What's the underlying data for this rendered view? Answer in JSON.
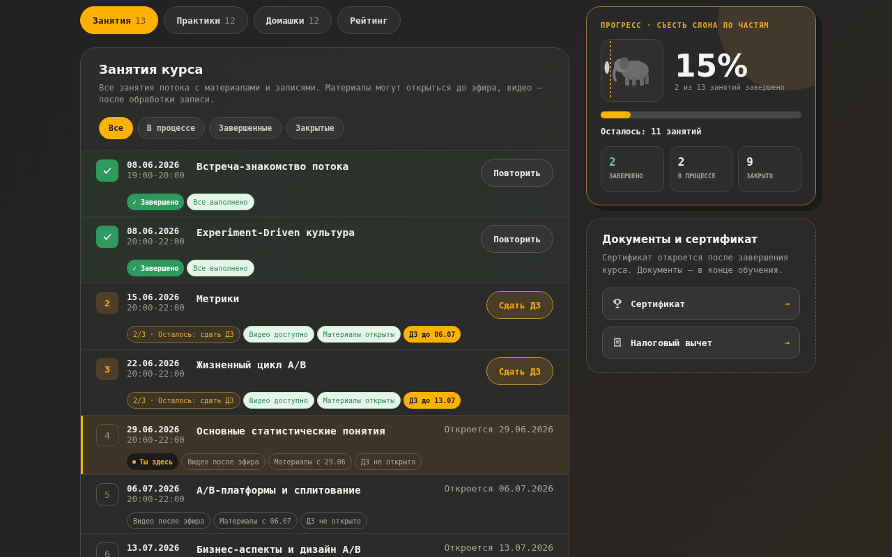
{
  "tabs": [
    {
      "label": "Занятия",
      "count": "13",
      "selected": true
    },
    {
      "label": "Практики",
      "count": "12",
      "selected": false
    },
    {
      "label": "Домашки",
      "count": "12",
      "selected": false
    },
    {
      "label": "Рейтинг",
      "selected": false
    }
  ],
  "course": {
    "title": "Занятия курса",
    "description": "Все занятия потока с материалами и записями. Материалы могут открыться до эфира, видео — после обработки записи.",
    "filters": [
      {
        "label": "Все",
        "selected": true
      },
      {
        "label": "В процессе",
        "selected": false
      },
      {
        "label": "Завершенные",
        "selected": false
      },
      {
        "label": "Закрытые",
        "selected": false
      }
    ]
  },
  "lessons": [
    {
      "kind": "done",
      "current": false,
      "date": "08.06.2026",
      "time": "19:00-20:00",
      "title": "Встреча-знакомство потока",
      "action": "Повторить",
      "tags": [
        {
          "kind": "done",
          "text": "✓ Завершено"
        },
        {
          "kind": "success",
          "text": "Все выполнено"
        }
      ]
    },
    {
      "kind": "done",
      "current": false,
      "date": "08.06.2026",
      "time": "20:00-22:00",
      "title": "Experiment-Driven культура",
      "action": "Повторить",
      "tags": [
        {
          "kind": "done",
          "text": "✓ Завершено"
        },
        {
          "kind": "success",
          "text": "Все выполнено"
        }
      ]
    },
    {
      "kind": "active",
      "current": false,
      "number": "2",
      "date": "15.06.2026",
      "time": "20:00-22:00",
      "title": "Метрики",
      "action": "Сдать ДЗ",
      "tags": [
        {
          "kind": "progress",
          "text": "2/3 · Осталось: сдать ДЗ"
        },
        {
          "kind": "success",
          "text": "Видео доступно"
        },
        {
          "kind": "success",
          "text": "Материалы открыты"
        },
        {
          "kind": "deadline",
          "text": "ДЗ до 06.07"
        }
      ]
    },
    {
      "kind": "active",
      "current": false,
      "number": "3",
      "date": "22.06.2026",
      "time": "20:00-22:00",
      "title": "Жизненный цикл A/B",
      "action": "Сдать ДЗ",
      "tags": [
        {
          "kind": "progress",
          "text": "2/3 · Осталось: сдать ДЗ"
        },
        {
          "kind": "success",
          "text": "Видео доступно"
        },
        {
          "kind": "success",
          "text": "Материалы открыты"
        },
        {
          "kind": "deadline",
          "text": "ДЗ до 13.07"
        }
      ]
    },
    {
      "kind": "locked",
      "current": true,
      "number": "4",
      "date": "29.06.2026",
      "time": "20:00-22:00",
      "title": "Основные статистические понятия",
      "opens": "Откроется 29.06.2026",
      "tags": [
        {
          "kind": "here",
          "text": "Ты здесь"
        },
        {
          "kind": "muted",
          "text": "Видео после эфира"
        },
        {
          "kind": "muted",
          "text": "Материалы с 29.06"
        },
        {
          "kind": "muted",
          "text": "ДЗ не открыто"
        }
      ]
    },
    {
      "kind": "locked",
      "current": false,
      "number": "5",
      "date": "06.07.2026",
      "time": "20:00-22:00",
      "title": "A/B-платформы и сплитование",
      "opens": "Откроется 06.07.2026",
      "tags": [
        {
          "kind": "muted",
          "text": "Видео после эфира"
        },
        {
          "kind": "muted",
          "text": "Материалы с 06.07"
        },
        {
          "kind": "muted",
          "text": "ДЗ не открыто"
        }
      ]
    },
    {
      "kind": "locked",
      "current": false,
      "number": "6",
      "date": "13.07.2026",
      "title": "Бизнес-аспекты и дизайн A/B",
      "opens": "Откроется 13.07.2026"
    }
  ],
  "progress": {
    "heading": "ПРОГРЕСС · СЪЕСТЬ СЛОНА ПО ЧАСТЯМ",
    "percent": "15%",
    "caption": "2 из 13 занятий завершено",
    "level": 0.15,
    "remaining": "Осталось: 11 занятий",
    "stats": [
      {
        "value": "2",
        "label": "ЗАВЕРШЕНО",
        "color": "#5fd08a"
      },
      {
        "value": "2",
        "label": "В ПРОЦЕССЕ",
        "color": "#f2f2f2"
      },
      {
        "value": "9",
        "label": "ЗАКРЫТО",
        "color": "#f2f2f2"
      }
    ]
  },
  "documents": {
    "title": "Документы и сертификат",
    "description": "Сертификат откроется после завершения курса. Документы — в конце обучения.",
    "items": [
      {
        "kind": "trophy",
        "label": "Сертификат",
        "arrow": "→"
      },
      {
        "kind": "receipt",
        "label": "Налоговый вычет",
        "arrow": "→"
      }
    ]
  }
}
